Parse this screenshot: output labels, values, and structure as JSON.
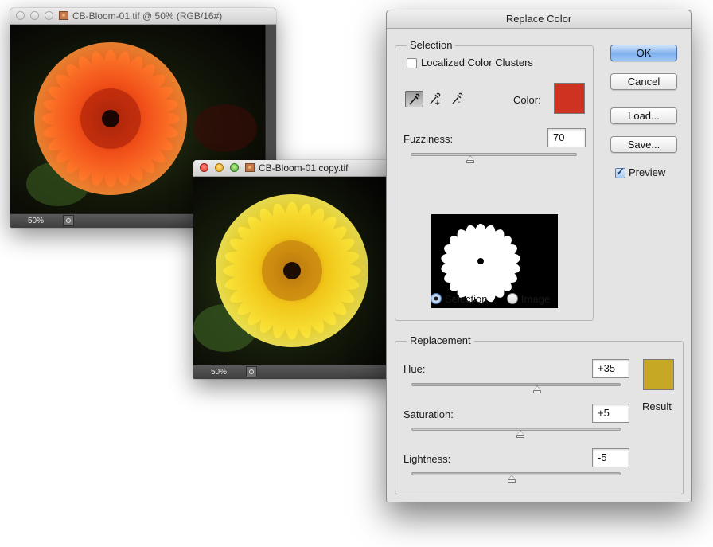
{
  "window1": {
    "title": "CB-Bloom-01.tif @ 50% (RGB/16#)",
    "zoom": "50%",
    "flower_color": "#f2541a"
  },
  "window2": {
    "title": "CB-Bloom-01 copy.tif",
    "zoom": "50%",
    "flower_color": "#f0d21a"
  },
  "dialog": {
    "title": "Replace Color",
    "selection": {
      "label": "Selection",
      "localized_clusters_label": "Localized Color Clusters",
      "localized_clusters_checked": false,
      "color_label": "Color:",
      "color": "#cf3220",
      "fuzziness_label": "Fuzziness:",
      "fuzziness_value": "70",
      "fuzziness_level": 0.36,
      "radio_selection_label": "Selection",
      "radio_image_label": "Image",
      "selected_mode": "Selection"
    },
    "replacement": {
      "label": "Replacement",
      "hue_label": "Hue:",
      "hue_value": "+35",
      "hue_level": 0.6,
      "saturation_label": "Saturation:",
      "saturation_value": "+5",
      "saturation_level": 0.52,
      "lightness_label": "Lightness:",
      "lightness_value": "-5",
      "lightness_level": 0.48,
      "result_label": "Result",
      "result_color": "#c7a824"
    },
    "buttons": {
      "ok": "OK",
      "cancel": "Cancel",
      "load": "Load...",
      "save": "Save..."
    },
    "preview_label": "Preview",
    "preview_checked": true
  }
}
